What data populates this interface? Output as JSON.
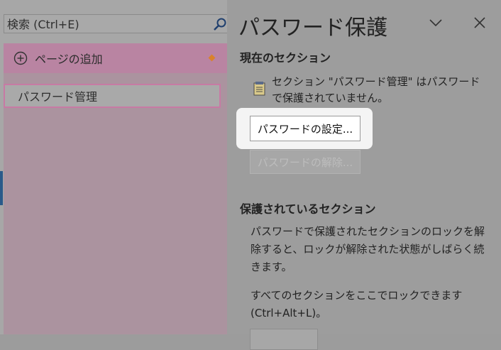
{
  "search": {
    "placeholder": "検索 (Ctrl+E)",
    "icon": "search-icon"
  },
  "pages": {
    "add_label": "ページの追加",
    "items": [
      {
        "label": "パスワード管理"
      }
    ]
  },
  "pane": {
    "title": "パスワード保護",
    "current_section": {
      "heading": "現在のセクション",
      "status_line1": "セクション \"パスワード管理\" はパスワード",
      "status_line2": "で保護されていません。",
      "set_password_label": "パスワードの設定...",
      "remove_password_label": "パスワードの解除..."
    },
    "protected_sections": {
      "heading": "保護されているセクション",
      "description_line1": "パスワードで保護されたセクションのロックを解",
      "description_line2": "除すると、ロックが解除された状態がしばらく続",
      "description_line3": "きます。",
      "lock_all_line1": "すべてのセクションをここでロックできます",
      "lock_all_line2": "(Ctrl+Alt+L)。"
    }
  },
  "colors": {
    "accent_pink": "#b984a2",
    "page_border": "#c77aa4",
    "marker_orange": "#d9822b",
    "spotlight": "#f4f4f4"
  }
}
